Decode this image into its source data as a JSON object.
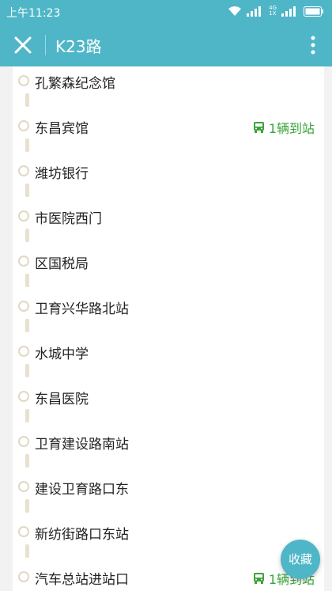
{
  "status_bar": {
    "time": "上午11:23",
    "network_top": "4G",
    "network_bottom": "1X"
  },
  "header": {
    "title": "K23路"
  },
  "stops": [
    {
      "name": "孔繁森纪念馆",
      "bus": ""
    },
    {
      "name": "东昌宾馆",
      "bus": "1辆到站"
    },
    {
      "name": "潍坊银行",
      "bus": ""
    },
    {
      "name": "市医院西门",
      "bus": ""
    },
    {
      "name": "区国税局",
      "bus": ""
    },
    {
      "name": "卫育兴华路北站",
      "bus": ""
    },
    {
      "name": "水城中学",
      "bus": ""
    },
    {
      "name": "东昌医院",
      "bus": ""
    },
    {
      "name": "卫育建设路南站",
      "bus": ""
    },
    {
      "name": "建设卫育路口东",
      "bus": ""
    },
    {
      "name": "新纺街路口东站",
      "bus": ""
    },
    {
      "name": "汽车总站进站口",
      "bus": "1辆到站"
    }
  ],
  "favorite_button": "收藏",
  "colors": {
    "primary": "#4fb6c8",
    "bus_arrival": "#3aa33a",
    "stop_marker": "#e2d8c2"
  }
}
